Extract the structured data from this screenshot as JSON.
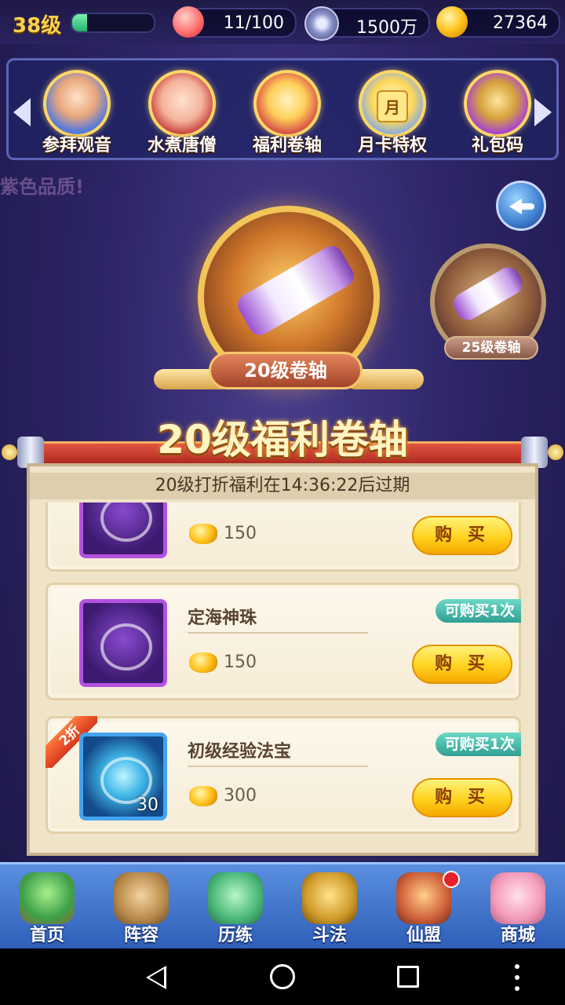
{
  "status": {
    "level": "38级",
    "exp_fraction": 0.18,
    "stamina": "11/100",
    "coins": "1500万",
    "gold": "27364"
  },
  "activities": [
    {
      "label": "参拜观音",
      "icon": "guanyin-portrait-icon"
    },
    {
      "label": "水煮唐僧",
      "icon": "tangseng-portrait-icon"
    },
    {
      "label": "福利卷轴",
      "icon": "scroll-gift-icon"
    },
    {
      "label": "月卡特权",
      "icon": "monthly-card-icon",
      "badge": "月"
    },
    {
      "label": "礼包码",
      "icon": "gift-box-icon"
    }
  ],
  "ticker": "紫色品质!",
  "scrolls": {
    "main_label": "20级卷轴",
    "side_label": "25级卷轴"
  },
  "banner": {
    "title": "20级福利卷轴",
    "timer_text": "20级打折福利在14:36:22后过期"
  },
  "items": [
    {
      "name": "",
      "price": "150",
      "buy_label": "购 买",
      "limit": "",
      "discount": "",
      "count": ""
    },
    {
      "name": "定海神珠",
      "price": "150",
      "buy_label": "购 买",
      "limit": "可购买1次",
      "discount": "",
      "count": ""
    },
    {
      "name": "初级经验法宝",
      "price": "300",
      "buy_label": "购 买",
      "limit": "可购买1次",
      "discount": "2折",
      "count": "30"
    }
  ],
  "nav": [
    {
      "label": "首页"
    },
    {
      "label": "阵容"
    },
    {
      "label": "历练"
    },
    {
      "label": "斗法"
    },
    {
      "label": "仙盟",
      "alert": true
    },
    {
      "label": "商城"
    }
  ],
  "colors": {
    "gold_text": "#ffd34a",
    "buy_button": "#ffd21f",
    "limit_tag": "#2f9f93",
    "ribbon": "#c8352a",
    "nav_bg": "#2f5fb8"
  }
}
